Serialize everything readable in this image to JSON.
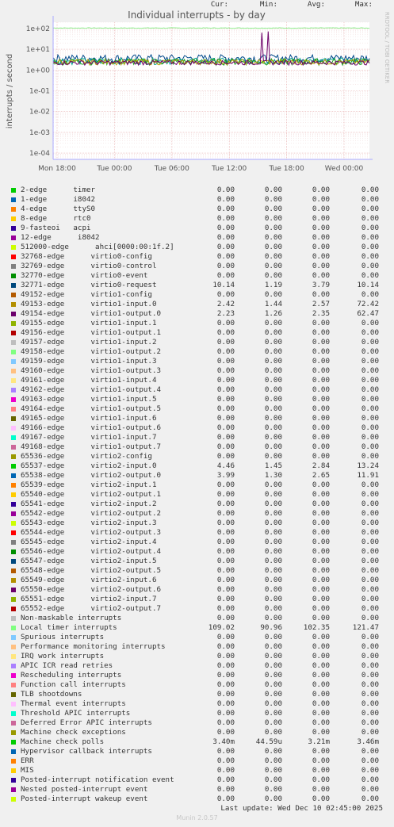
{
  "chart_data": {
    "type": "line",
    "title": "Individual interrupts - by day",
    "ylabel": "interrupts / second",
    "yscale": "log",
    "ylim": [
      5e-05,
      200
    ],
    "y_ticks": [
      "1e+02",
      "1e+01",
      "1e+00",
      "1e-01",
      "1e-02",
      "1e-03",
      "1e-04"
    ],
    "x_ticks": [
      "Mon 18:00",
      "Tue 00:00",
      "Tue 06:00",
      "Tue 12:00",
      "Tue 18:00",
      "Wed 00:00"
    ],
    "side_label": "RRDTOOL / TOBI OETIKER",
    "grid": true,
    "plotted_series": [
      {
        "name": "Local timer interrupts",
        "color": "#8ff08f",
        "level": 105,
        "noise": 0.04
      },
      {
        "name": "32771-edge",
        "color": "#00498b",
        "level": 3.8,
        "noise": 0.45
      },
      {
        "name": "65537-edge",
        "color": "#00a090",
        "level": 2.8,
        "noise": 0.35
      },
      {
        "name": "65538-edge",
        "color": "#1a9e1a",
        "level": 2.6,
        "noise": 0.35
      },
      {
        "name": "49153-edge",
        "color": "#b0a000",
        "level": 2.5,
        "noise": 0.3
      },
      {
        "name": "49154-edge",
        "color": "#6d0068",
        "level": 2.3,
        "noise": 0.25,
        "spikes": [
          {
            "t": 0.66,
            "v": 62.47
          },
          {
            "t": 0.68,
            "v": 72.42
          }
        ]
      },
      {
        "name": "Machine check polls",
        "color": "#00a000",
        "level": 0.0032,
        "dips": true
      }
    ]
  },
  "legend": {
    "headers": {
      "cur": "Cur:",
      "min": "Min:",
      "avg": "Avg:",
      "max": "Max:"
    },
    "rows": [
      {
        "label": "2-edge      timer",
        "color": "#00cc00",
        "cur": "0.00",
        "min": "0.00",
        "avg": "0.00",
        "max": "0.00"
      },
      {
        "label": "1-edge      i8042",
        "color": "#0066b3",
        "cur": "0.00",
        "min": "0.00",
        "avg": "0.00",
        "max": "0.00"
      },
      {
        "label": "4-edge      ttyS0",
        "color": "#ff8000",
        "cur": "0.00",
        "min": "0.00",
        "avg": "0.00",
        "max": "0.00"
      },
      {
        "label": "8-edge      rtc0",
        "color": "#ffcc00",
        "cur": "0.00",
        "min": "0.00",
        "avg": "0.00",
        "max": "0.00"
      },
      {
        "label": "9-fasteoi   acpi",
        "color": "#330099",
        "cur": "0.00",
        "min": "0.00",
        "avg": "0.00",
        "max": "0.00"
      },
      {
        "label": "12-edge      i8042",
        "color": "#990099",
        "cur": "0.00",
        "min": "0.00",
        "avg": "0.00",
        "max": "0.00"
      },
      {
        "label": "512000-edge      ahci[0000:00:1f.2]",
        "color": "#ccff00",
        "cur": "0.00",
        "min": "0.00",
        "avg": "0.00",
        "max": "0.00"
      },
      {
        "label": "32768-edge      virtio0-config",
        "color": "#ff0000",
        "cur": "0.00",
        "min": "0.00",
        "avg": "0.00",
        "max": "0.00"
      },
      {
        "label": "32769-edge      virtio0-control",
        "color": "#808080",
        "cur": "0.00",
        "min": "0.00",
        "avg": "0.00",
        "max": "0.00"
      },
      {
        "label": "32770-edge      virtio0-event",
        "color": "#008f00",
        "cur": "0.00",
        "min": "0.00",
        "avg": "0.00",
        "max": "0.00"
      },
      {
        "label": "32771-edge      virtio0-request",
        "color": "#00487d",
        "cur": "10.14",
        "min": "1.19",
        "avg": "3.79",
        "max": "10.14"
      },
      {
        "label": "49152-edge      virtio1-config",
        "color": "#b35a00",
        "cur": "0.00",
        "min": "0.00",
        "avg": "0.00",
        "max": "0.00"
      },
      {
        "label": "49153-edge      virtio1-input.0",
        "color": "#b38f00",
        "cur": "2.42",
        "min": "1.44",
        "avg": "2.57",
        "max": "72.42"
      },
      {
        "label": "49154-edge      virtio1-output.0",
        "color": "#6b006b",
        "cur": "2.23",
        "min": "1.26",
        "avg": "2.35",
        "max": "62.47"
      },
      {
        "label": "49155-edge      virtio1-input.1",
        "color": "#8fb300",
        "cur": "0.00",
        "min": "0.00",
        "avg": "0.00",
        "max": "0.00"
      },
      {
        "label": "49156-edge      virtio1-output.1",
        "color": "#b30000",
        "cur": "0.00",
        "min": "0.00",
        "avg": "0.00",
        "max": "0.00"
      },
      {
        "label": "49157-edge      virtio1-input.2",
        "color": "#bebebe",
        "cur": "0.00",
        "min": "0.00",
        "avg": "0.00",
        "max": "0.00"
      },
      {
        "label": "49158-edge      virtio1-output.2",
        "color": "#80ff80",
        "cur": "0.00",
        "min": "0.00",
        "avg": "0.00",
        "max": "0.00"
      },
      {
        "label": "49159-edge      virtio1-input.3",
        "color": "#80c9ff",
        "cur": "0.00",
        "min": "0.00",
        "avg": "0.00",
        "max": "0.00"
      },
      {
        "label": "49160-edge      virtio1-output.3",
        "color": "#ffc080",
        "cur": "0.00",
        "min": "0.00",
        "avg": "0.00",
        "max": "0.00"
      },
      {
        "label": "49161-edge      virtio1-input.4",
        "color": "#ffe680",
        "cur": "0.00",
        "min": "0.00",
        "avg": "0.00",
        "max": "0.00"
      },
      {
        "label": "49162-edge      virtio1-output.4",
        "color": "#aa80ff",
        "cur": "0.00",
        "min": "0.00",
        "avg": "0.00",
        "max": "0.00"
      },
      {
        "label": "49163-edge      virtio1-input.5",
        "color": "#ee00cc",
        "cur": "0.00",
        "min": "0.00",
        "avg": "0.00",
        "max": "0.00"
      },
      {
        "label": "49164-edge      virtio1-output.5",
        "color": "#ff8080",
        "cur": "0.00",
        "min": "0.00",
        "avg": "0.00",
        "max": "0.00"
      },
      {
        "label": "49165-edge      virtio1-input.6",
        "color": "#666600",
        "cur": "0.00",
        "min": "0.00",
        "avg": "0.00",
        "max": "0.00"
      },
      {
        "label": "49166-edge      virtio1-output.6",
        "color": "#ffbfff",
        "cur": "0.00",
        "min": "0.00",
        "avg": "0.00",
        "max": "0.00"
      },
      {
        "label": "49167-edge      virtio1-input.7",
        "color": "#00ffcc",
        "cur": "0.00",
        "min": "0.00",
        "avg": "0.00",
        "max": "0.00"
      },
      {
        "label": "49168-edge      virtio1-output.7",
        "color": "#cc6699",
        "cur": "0.00",
        "min": "0.00",
        "avg": "0.00",
        "max": "0.00"
      },
      {
        "label": "65536-edge      virtio2-config",
        "color": "#999900",
        "cur": "0.00",
        "min": "0.00",
        "avg": "0.00",
        "max": "0.00"
      },
      {
        "label": "65537-edge      virtio2-input.0",
        "color": "#00cc00",
        "cur": "4.46",
        "min": "1.45",
        "avg": "2.84",
        "max": "13.24"
      },
      {
        "label": "65538-edge      virtio2-output.0",
        "color": "#0066b3",
        "cur": "3.99",
        "min": "1.30",
        "avg": "2.65",
        "max": "11.91"
      },
      {
        "label": "65539-edge      virtio2-input.1",
        "color": "#ff8000",
        "cur": "0.00",
        "min": "0.00",
        "avg": "0.00",
        "max": "0.00"
      },
      {
        "label": "65540-edge      virtio2-output.1",
        "color": "#ffcc00",
        "cur": "0.00",
        "min": "0.00",
        "avg": "0.00",
        "max": "0.00"
      },
      {
        "label": "65541-edge      virtio2-input.2",
        "color": "#330099",
        "cur": "0.00",
        "min": "0.00",
        "avg": "0.00",
        "max": "0.00"
      },
      {
        "label": "65542-edge      virtio2-output.2",
        "color": "#990099",
        "cur": "0.00",
        "min": "0.00",
        "avg": "0.00",
        "max": "0.00"
      },
      {
        "label": "65543-edge      virtio2-input.3",
        "color": "#ccff00",
        "cur": "0.00",
        "min": "0.00",
        "avg": "0.00",
        "max": "0.00"
      },
      {
        "label": "65544-edge      virtio2-output.3",
        "color": "#ff0000",
        "cur": "0.00",
        "min": "0.00",
        "avg": "0.00",
        "max": "0.00"
      },
      {
        "label": "65545-edge      virtio2-input.4",
        "color": "#808080",
        "cur": "0.00",
        "min": "0.00",
        "avg": "0.00",
        "max": "0.00"
      },
      {
        "label": "65546-edge      virtio2-output.4",
        "color": "#008f00",
        "cur": "0.00",
        "min": "0.00",
        "avg": "0.00",
        "max": "0.00"
      },
      {
        "label": "65547-edge      virtio2-input.5",
        "color": "#00487d",
        "cur": "0.00",
        "min": "0.00",
        "avg": "0.00",
        "max": "0.00"
      },
      {
        "label": "65548-edge      virtio2-output.5",
        "color": "#b35a00",
        "cur": "0.00",
        "min": "0.00",
        "avg": "0.00",
        "max": "0.00"
      },
      {
        "label": "65549-edge      virtio2-input.6",
        "color": "#b38f00",
        "cur": "0.00",
        "min": "0.00",
        "avg": "0.00",
        "max": "0.00"
      },
      {
        "label": "65550-edge      virtio2-output.6",
        "color": "#6b006b",
        "cur": "0.00",
        "min": "0.00",
        "avg": "0.00",
        "max": "0.00"
      },
      {
        "label": "65551-edge      virtio2-input.7",
        "color": "#8fb300",
        "cur": "0.00",
        "min": "0.00",
        "avg": "0.00",
        "max": "0.00"
      },
      {
        "label": "65552-edge      virtio2-output.7",
        "color": "#b30000",
        "cur": "0.00",
        "min": "0.00",
        "avg": "0.00",
        "max": "0.00"
      },
      {
        "label": "Non-maskable interrupts",
        "color": "#bebebe",
        "cur": "0.00",
        "min": "0.00",
        "avg": "0.00",
        "max": "0.00"
      },
      {
        "label": "Local timer interrupts",
        "color": "#80ff80",
        "cur": "109.02",
        "min": "90.96",
        "avg": "102.35",
        "max": "121.47"
      },
      {
        "label": "Spurious interrupts",
        "color": "#80c9ff",
        "cur": "0.00",
        "min": "0.00",
        "avg": "0.00",
        "max": "0.00"
      },
      {
        "label": "Performance monitoring interrupts",
        "color": "#ffc080",
        "cur": "0.00",
        "min": "0.00",
        "avg": "0.00",
        "max": "0.00"
      },
      {
        "label": "IRQ work interrupts",
        "color": "#ffe680",
        "cur": "0.00",
        "min": "0.00",
        "avg": "0.00",
        "max": "0.00"
      },
      {
        "label": "APIC ICR read retries",
        "color": "#aa80ff",
        "cur": "0.00",
        "min": "0.00",
        "avg": "0.00",
        "max": "0.00"
      },
      {
        "label": "Rescheduling interrupts",
        "color": "#ee00cc",
        "cur": "0.00",
        "min": "0.00",
        "avg": "0.00",
        "max": "0.00"
      },
      {
        "label": "Function call interrupts",
        "color": "#ff8080",
        "cur": "0.00",
        "min": "0.00",
        "avg": "0.00",
        "max": "0.00"
      },
      {
        "label": "TLB shootdowns",
        "color": "#666600",
        "cur": "0.00",
        "min": "0.00",
        "avg": "0.00",
        "max": "0.00"
      },
      {
        "label": "Thermal event interrupts",
        "color": "#ffbfff",
        "cur": "0.00",
        "min": "0.00",
        "avg": "0.00",
        "max": "0.00"
      },
      {
        "label": "Threshold APIC interrupts",
        "color": "#00ffcc",
        "cur": "0.00",
        "min": "0.00",
        "avg": "0.00",
        "max": "0.00"
      },
      {
        "label": "Deferred Error APIC interrupts",
        "color": "#cc6699",
        "cur": "0.00",
        "min": "0.00",
        "avg": "0.00",
        "max": "0.00"
      },
      {
        "label": "Machine check exceptions",
        "color": "#999900",
        "cur": "0.00",
        "min": "0.00",
        "avg": "0.00",
        "max": "0.00"
      },
      {
        "label": "Machine check polls",
        "color": "#00cc00",
        "cur": "3.40m",
        "min": "44.59u",
        "avg": "3.21m",
        "max": "3.46m"
      },
      {
        "label": "Hypervisor callback interrupts",
        "color": "#0066b3",
        "cur": "0.00",
        "min": "0.00",
        "avg": "0.00",
        "max": "0.00"
      },
      {
        "label": "ERR",
        "color": "#ff8000",
        "cur": "0.00",
        "min": "0.00",
        "avg": "0.00",
        "max": "0.00"
      },
      {
        "label": "MIS",
        "color": "#ffcc00",
        "cur": "0.00",
        "min": "0.00",
        "avg": "0.00",
        "max": "0.00"
      },
      {
        "label": "Posted-interrupt notification event",
        "color": "#330099",
        "cur": "0.00",
        "min": "0.00",
        "avg": "0.00",
        "max": "0.00"
      },
      {
        "label": "Nested posted-interrupt event",
        "color": "#990099",
        "cur": "0.00",
        "min": "0.00",
        "avg": "0.00",
        "max": "0.00"
      },
      {
        "label": "Posted-interrupt wakeup event",
        "color": "#ccff00",
        "cur": "0.00",
        "min": "0.00",
        "avg": "0.00",
        "max": "0.00"
      }
    ]
  },
  "footer": {
    "last_update": "Last update: Wed Dec 10 02:45:00 2025",
    "version": "Munin 2.0.57"
  }
}
